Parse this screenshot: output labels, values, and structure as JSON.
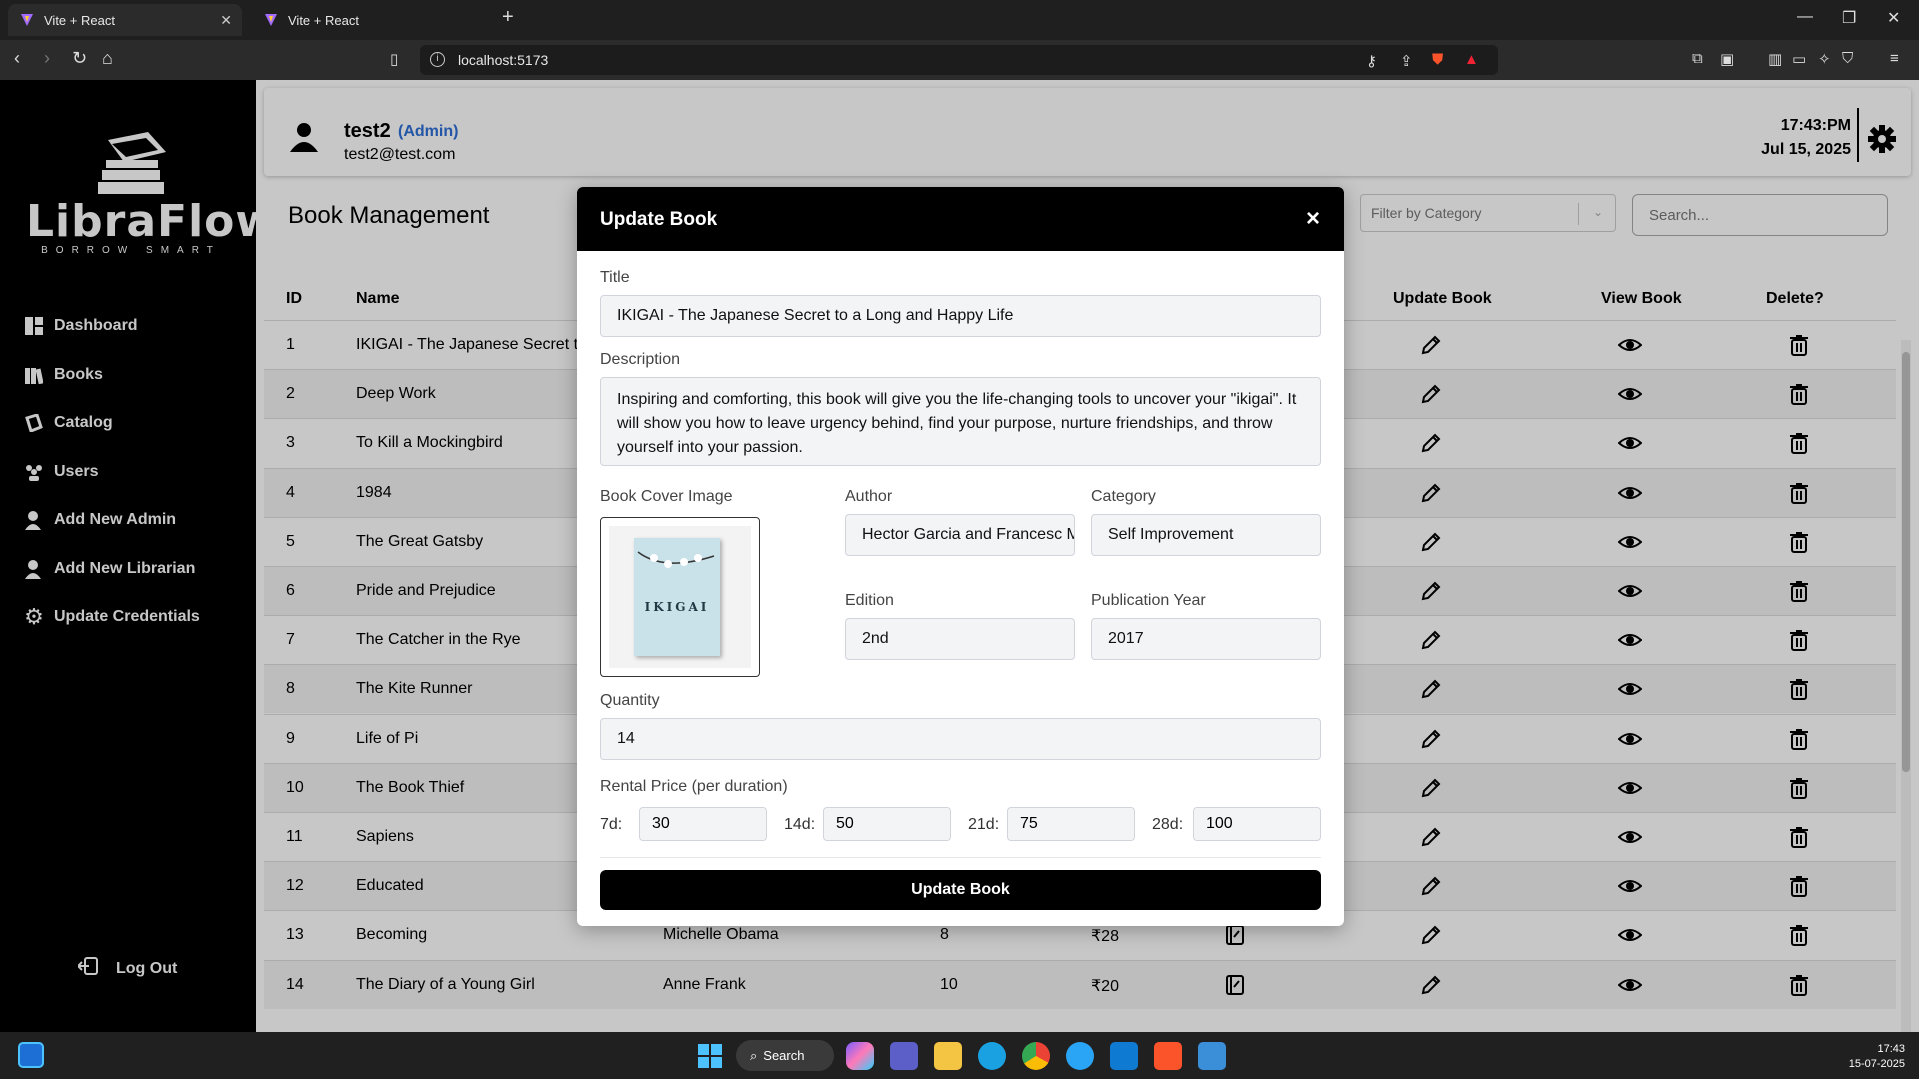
{
  "browser": {
    "tabs": [
      {
        "label": "Vite + React",
        "active": true
      },
      {
        "label": "Vite + React",
        "active": false
      }
    ],
    "url": "localhost:5173"
  },
  "app": {
    "logo_text": "LibraFlow",
    "logo_tagline": "BORROW SMART"
  },
  "sidebar": {
    "items": [
      {
        "label": "Dashboard",
        "icon": "dashboard-icon"
      },
      {
        "label": "Books",
        "icon": "books-icon"
      },
      {
        "label": "Catalog",
        "icon": "catalog-icon"
      },
      {
        "label": "Users",
        "icon": "users-icon"
      },
      {
        "label": "Add New Admin",
        "icon": "add-admin-icon"
      },
      {
        "label": "Add New Librarian",
        "icon": "add-librarian-icon"
      },
      {
        "label": "Update Credentials",
        "icon": "gear-icon"
      }
    ],
    "logout_label": "Log Out"
  },
  "header": {
    "user_name": "test2",
    "user_role": "(Admin)",
    "user_email": "test2@test.com",
    "time": "17:43:PM",
    "date": "Jul 15, 2025"
  },
  "page": {
    "title": "Book Management",
    "filter_placeholder": "Filter by Category",
    "search_placeholder": "Search..."
  },
  "table": {
    "headers": {
      "id": "ID",
      "name": "Name",
      "update": "Update Book",
      "view": "View Book",
      "delete": "Delete?"
    },
    "rows": [
      {
        "id": "1",
        "name": "IKIGAI - The Japanese Secret to",
        "author": "",
        "qty": "",
        "price": ""
      },
      {
        "id": "2",
        "name": "Deep Work",
        "author": "",
        "qty": "",
        "price": ""
      },
      {
        "id": "3",
        "name": "To Kill a Mockingbird",
        "author": "",
        "qty": "",
        "price": ""
      },
      {
        "id": "4",
        "name": "1984",
        "author": "",
        "qty": "",
        "price": ""
      },
      {
        "id": "5",
        "name": "The Great Gatsby",
        "author": "",
        "qty": "",
        "price": ""
      },
      {
        "id": "6",
        "name": "Pride and Prejudice",
        "author": "",
        "qty": "",
        "price": ""
      },
      {
        "id": "7",
        "name": "The Catcher in the Rye",
        "author": "",
        "qty": "",
        "price": ""
      },
      {
        "id": "8",
        "name": "The Kite Runner",
        "author": "",
        "qty": "",
        "price": ""
      },
      {
        "id": "9",
        "name": "Life of Pi",
        "author": "",
        "qty": "",
        "price": ""
      },
      {
        "id": "10",
        "name": "The Book Thief",
        "author": "",
        "qty": "",
        "price": ""
      },
      {
        "id": "11",
        "name": "Sapiens",
        "author": "",
        "qty": "",
        "price": ""
      },
      {
        "id": "12",
        "name": "Educated",
        "author": "",
        "qty": "",
        "price": ""
      },
      {
        "id": "13",
        "name": "Becoming",
        "author": "Michelle Obama",
        "qty": "8",
        "price": "₹28"
      },
      {
        "id": "14",
        "name": "The Diary of a Young Girl",
        "author": "Anne Frank",
        "qty": "10",
        "price": "₹20"
      }
    ]
  },
  "modal": {
    "title": "Update Book",
    "close_label": "×",
    "title_label": "Title",
    "title_value": "IKIGAI - The Japanese Secret to a Long and Happy Life",
    "description_label": "Description",
    "description_value": "Inspiring and comforting, this book will give you the life-changing tools to uncover your \"ikigai\". It will show you how to leave urgency behind, find your purpose, nurture friendships, and throw yourself into your passion.",
    "cover_label": "Book Cover Image",
    "cover_title": "IKIGAI",
    "author_label": "Author",
    "author_value": "Hector Garcia and Francesc Miralles",
    "category_label": "Category",
    "category_value": "Self Improvement",
    "edition_label": "Edition",
    "edition_value": "2nd",
    "year_label": "Publication Year",
    "year_value": "2017",
    "quantity_label": "Quantity",
    "quantity_value": "14",
    "rental_label": "Rental Price (per duration)",
    "prices": [
      {
        "label": "7d:",
        "value": "30"
      },
      {
        "label": "14d:",
        "value": "50"
      },
      {
        "label": "21d:",
        "value": "75"
      },
      {
        "label": "28d:",
        "value": "100"
      }
    ],
    "submit_label": "Update Book"
  },
  "taskbar": {
    "search_label": "Search",
    "time": "17:43",
    "date": "15-07-2025"
  }
}
